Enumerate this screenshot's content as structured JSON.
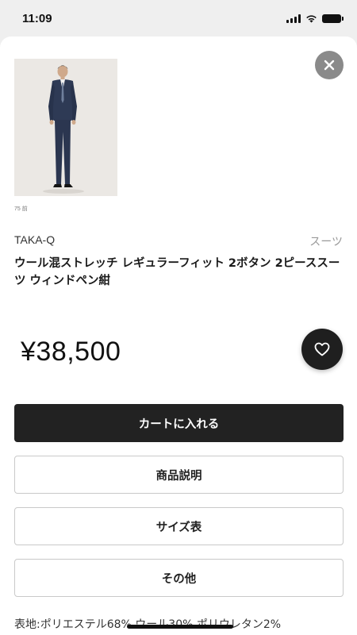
{
  "status": {
    "time": "11:09"
  },
  "product": {
    "image_caption": "75 前",
    "brand": "TAKA-Q",
    "category": "スーツ",
    "title": "ウール混ストレッチ レギュラーフィット 2ボタン 2ピーススーツ ウィンドペン紺",
    "price": "¥38,500",
    "material": "表地:ポリエステル68% ウール30% ポリウレタン2%"
  },
  "actions": {
    "add_to_cart": "カートに入れる",
    "description": "商品説明",
    "size_chart": "サイズ表",
    "other": "その他"
  },
  "icons": {
    "close": "close-icon",
    "favorite": "heart-icon",
    "signal": "signal-icon",
    "wifi": "wifi-icon",
    "battery": "battery-icon"
  },
  "colors": {
    "primary_button": "#222222",
    "favorite_button": "#1f1f1f",
    "close_button": "#8a8a8a",
    "category_text": "#9a9a9a"
  }
}
